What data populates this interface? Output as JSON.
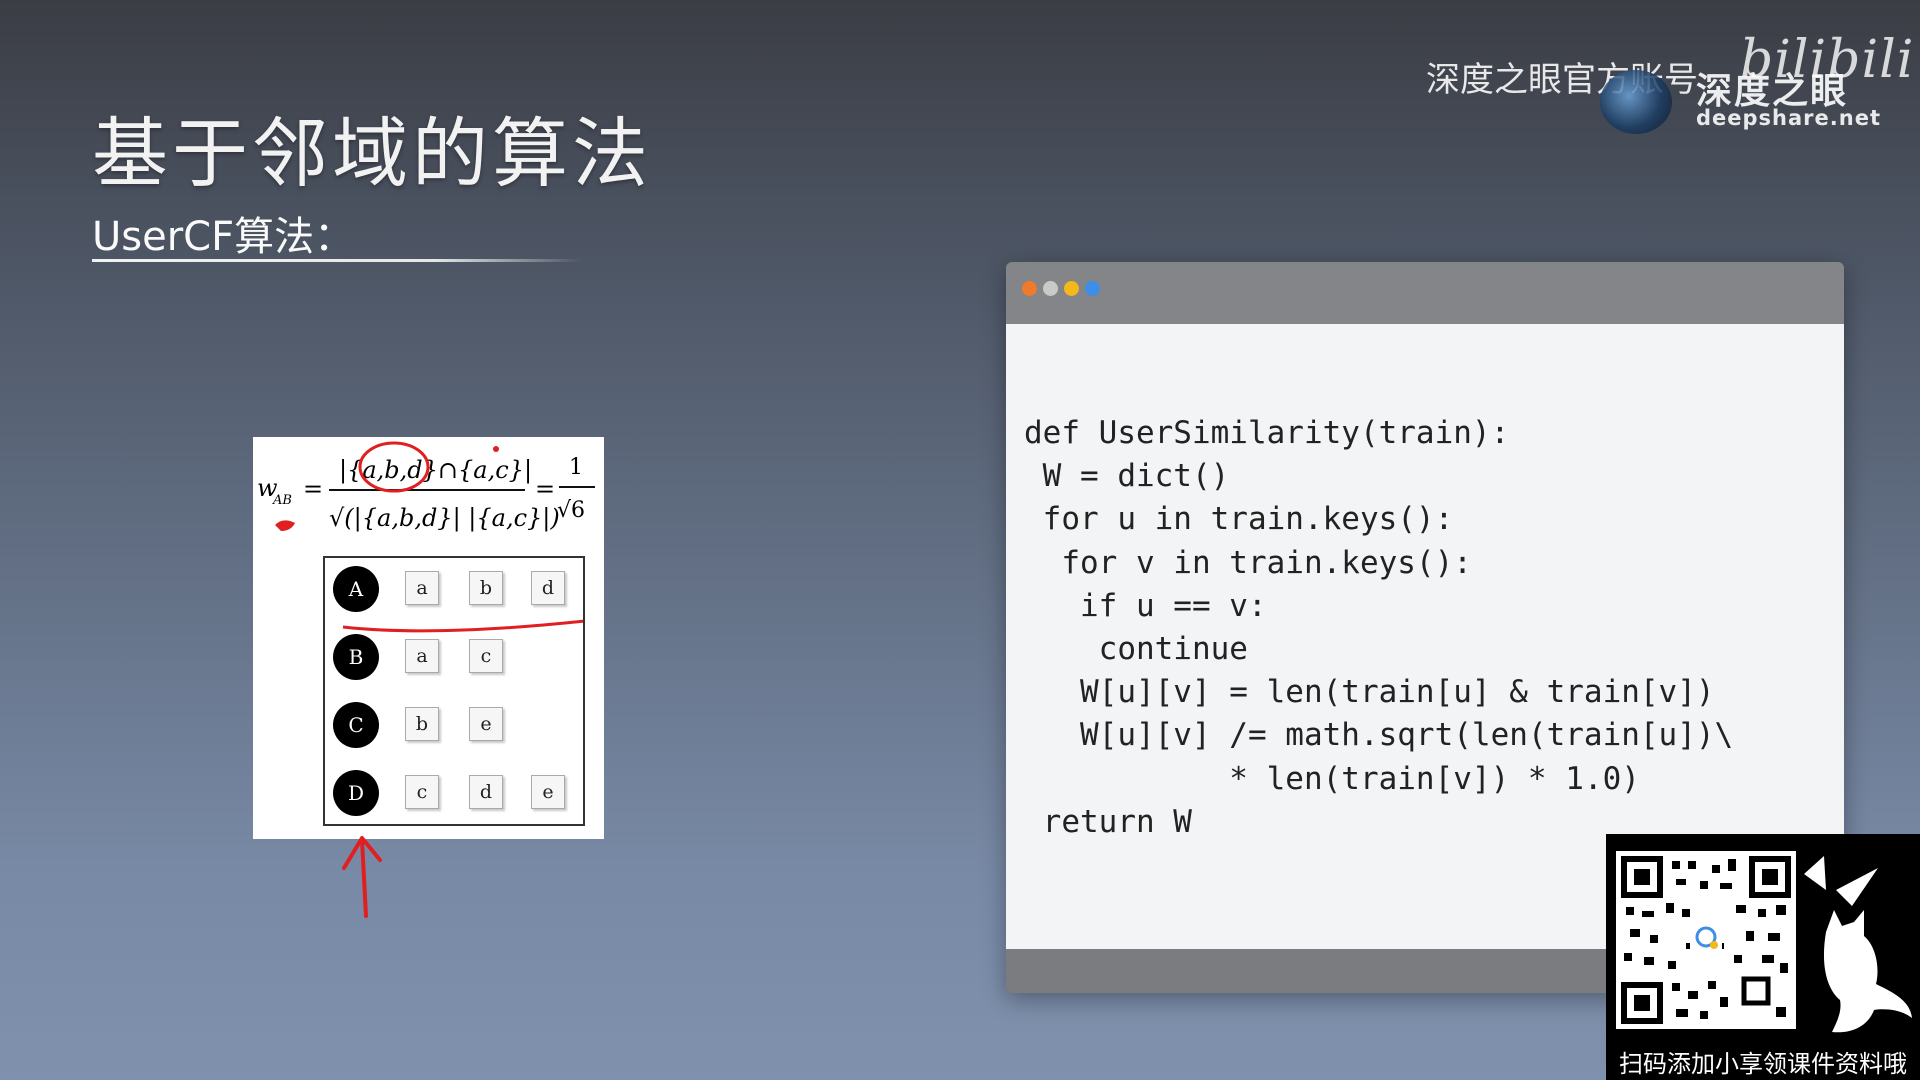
{
  "slide": {
    "title": "基于邻域的算法",
    "subtitle": "UserCF算法："
  },
  "watermark": {
    "account_text": "深度之眼官方账号",
    "brand": "深度之眼",
    "url": "deepshare.net",
    "platform": "bilibili"
  },
  "figure": {
    "formula": {
      "lhs": "w",
      "lhs_subscript": "AB",
      "numerator": "|{a,b,d}∩{a,c}|",
      "denominator": "√(|{a,b,d}| |{a,c}|)",
      "result_numerator": "1",
      "result_denominator": "√6"
    },
    "users": [
      {
        "id": "A",
        "items": [
          "a",
          "b",
          "d"
        ]
      },
      {
        "id": "B",
        "items": [
          "a",
          "c"
        ]
      },
      {
        "id": "C",
        "items": [
          "b",
          "e"
        ]
      },
      {
        "id": "D",
        "items": [
          "c",
          "d",
          "e"
        ]
      }
    ],
    "annotation_color": "#e02020"
  },
  "code_window": {
    "dot_colors": [
      "#ef7a2b",
      "#c9c9c9",
      "#f4b81a",
      "#3d8ee6"
    ],
    "lines": [
      "def UserSimilarity(train):",
      " W = dict()",
      " for u in train.keys():",
      "  for v in train.keys():",
      "   if u == v:",
      "    continue",
      "   W[u][v] = len(train[u] & train[v])",
      "   W[u][v] /= math.sqrt(len(train[u])\\",
      "           * len(train[v]) * 1.0)",
      " return W"
    ]
  },
  "promo": {
    "caption": "扫码添加小享领课件资料哦"
  }
}
